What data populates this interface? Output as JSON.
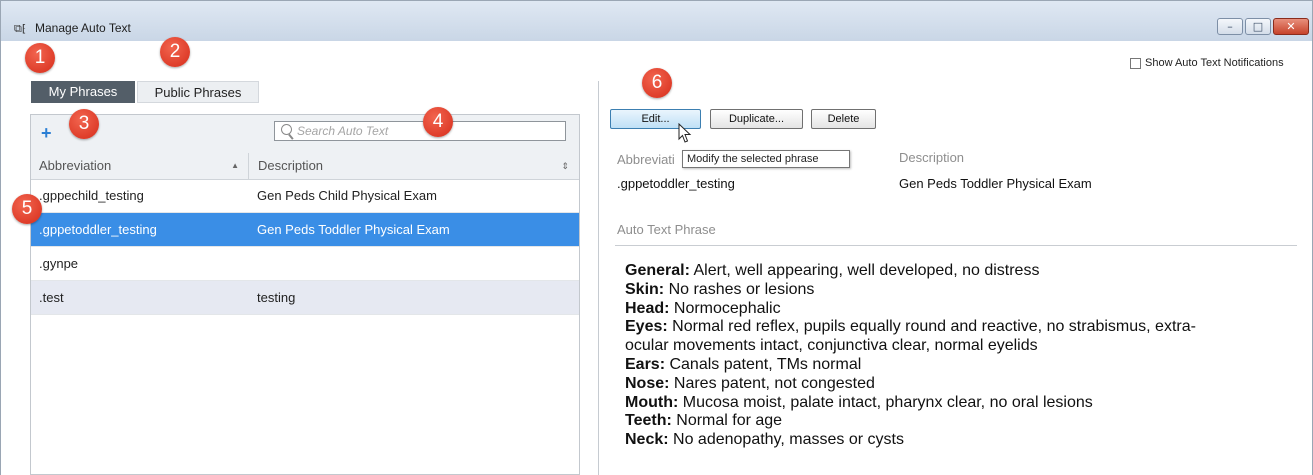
{
  "window": {
    "title": "Manage Auto Text",
    "controls": {
      "minimize": "–",
      "maximize": "□",
      "close": "✕"
    }
  },
  "badges": [
    "1",
    "2",
    "3",
    "4",
    "5",
    "6"
  ],
  "tabs": {
    "my_phrases": "My Phrases",
    "public_phrases": "Public Phrases"
  },
  "toolbar": {
    "add_glyph": "+",
    "search_placeholder": "Search Auto Text"
  },
  "table": {
    "columns": {
      "abbreviation": "Abbreviation",
      "description": "Description"
    },
    "sort_glyphs": {
      "abbreviation": "▲",
      "description": "⇕"
    },
    "rows": [
      {
        "abbreviation": ".gppechild_testing",
        "description": "Gen Peds Child Physical Exam"
      },
      {
        "abbreviation": ".gppetoddler_testing",
        "description": "Gen Peds Toddler Physical Exam"
      },
      {
        "abbreviation": ".gynpe",
        "description": ""
      },
      {
        "abbreviation": ".test",
        "description": "testing"
      }
    ],
    "selected_index": 1
  },
  "detail": {
    "show_notifications_label": "Show Auto Text Notifications",
    "show_notifications_checked": false,
    "buttons": {
      "edit": "Edit...",
      "duplicate": "Duplicate...",
      "delete": "Delete"
    },
    "tooltip": "Modify the selected phrase",
    "abbreviation_label": "Abbreviati",
    "description_label": "Description",
    "abbreviation_value": ".gppetoddler_testing",
    "description_value": "Gen Peds Toddler Physical Exam",
    "phrase_label": "Auto Text Phrase",
    "phrase_lines": [
      {
        "head": "General:",
        "text": " Alert, well appearing, well developed, no distress"
      },
      {
        "head": "Skin:",
        "text": " No rashes or lesions"
      },
      {
        "head": "Head:",
        "text": " Normocephalic"
      },
      {
        "head": "Eyes:",
        "text": " Normal red reflex, pupils equally round and reactive, no strabismus, extra-"
      },
      {
        "head": "",
        "text": "ocular movements intact, conjunctiva clear, normal eyelids"
      },
      {
        "head": "Ears:",
        "text": " Canals patent, TMs normal"
      },
      {
        "head": "Nose:",
        "text": " Nares patent, not congested"
      },
      {
        "head": "Mouth:",
        "text": " Mucosa moist, palate intact, pharynx clear, no oral lesions"
      },
      {
        "head": "Teeth:",
        "text": " Normal for age"
      },
      {
        "head": "Neck:",
        "text": " No adenopathy, masses or cysts"
      }
    ]
  },
  "colors": {
    "selected_row": "#3a8ee6",
    "alt_row": "#e6e9f2",
    "active_tab": "#535e68",
    "badge": "#e0402c",
    "add_icon": "#2b7fd4"
  },
  "icons": {
    "app": "auto-text-app-icon",
    "add": "plus-icon",
    "search": "search-icon",
    "cursor": "mouse-pointer-icon"
  }
}
